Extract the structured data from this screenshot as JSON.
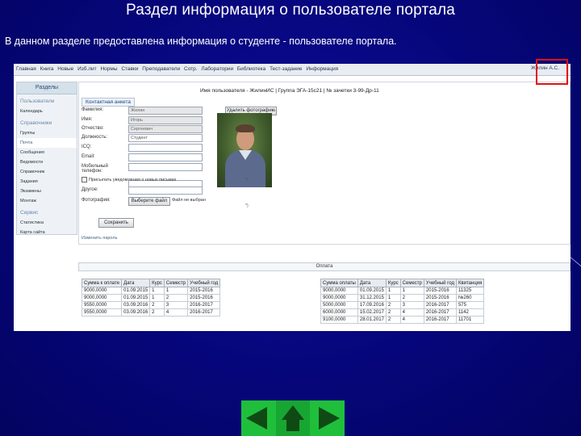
{
  "slide": {
    "title": "Раздел информация о пользователе портала",
    "subtitle": "В данном разделе предоставлена информация о студенте - пользователе портала."
  },
  "topnav": {
    "items": [
      "Главная",
      "Книга",
      "Новые",
      "Изб.лит",
      "Нормы",
      "Ставки",
      "Преподаватели",
      "Сотр.",
      "Лаборатории",
      "Библиотека",
      "Тест-задание",
      "Информация"
    ],
    "user_link": "Жилин А.С."
  },
  "sidebar": {
    "header": "Разделы",
    "items": [
      {
        "label": "Пользователи",
        "kind": "section"
      },
      {
        "label": "Календарь",
        "kind": "item"
      },
      {
        "label": "Справочники",
        "kind": "section"
      },
      {
        "label": "Группы",
        "kind": "item"
      },
      {
        "label": "Почта",
        "kind": "selected"
      },
      {
        "label": "Сообщения",
        "kind": "item"
      },
      {
        "label": "Ведомости",
        "kind": "item"
      },
      {
        "label": "Справочник",
        "kind": "item"
      },
      {
        "label": "Задания",
        "kind": "item"
      },
      {
        "label": "Экзамены",
        "kind": "item"
      },
      {
        "label": "Монтаж",
        "kind": "item"
      },
      {
        "label": "Сервис",
        "kind": "section"
      },
      {
        "label": "Статистика",
        "kind": "item"
      },
      {
        "label": "Карта сайта",
        "kind": "item"
      }
    ]
  },
  "profile": {
    "header": "Имя пользователя - ЖилинИС | Группа ЭГА-15с21 | № зачетки 3-99-Др-11",
    "tab_label": "Контактная анкета",
    "delete_photo_label": "Удалить фотографию",
    "fields": [
      {
        "label": "Фамилия:",
        "value": "Жилин",
        "readonly": true
      },
      {
        "label": "Имя:",
        "value": "Игорь",
        "readonly": true
      },
      {
        "label": "Отчество:",
        "value": "Сергеевич",
        "readonly": true
      },
      {
        "label": "Должность:",
        "value": "Студент",
        "readonly": false
      },
      {
        "label": "ICQ:",
        "value": "",
        "readonly": false
      },
      {
        "label": "Email:",
        "value": "",
        "readonly": false
      },
      {
        "label": "Мобильный телефон:",
        "value": "",
        "readonly": false
      },
      {
        "label": "",
        "value": "",
        "readonly": false
      }
    ],
    "checkbox_label": "Присылать уведомления о новых письмах",
    "other_label": "Другое:",
    "photo_label": "Фотография:",
    "browse_label": "Выберите файл",
    "file_status": "Файл не выбран",
    "save_label": "Сохранить",
    "side_marks": [
      "*)",
      "*)"
    ],
    "footnote": "Изменить пароль"
  },
  "tables": {
    "bar_label": "Оплата",
    "headers_left": [
      "Сумма к оплате",
      "Дата",
      "Курс",
      "Семестр",
      "Учебный год"
    ],
    "rows_left": [
      [
        "9000,0000",
        "01.09.2015",
        "1",
        "1",
        "2015-2016"
      ],
      [
        "9000,0000",
        "01.09.2015",
        "1",
        "2",
        "2015-2016"
      ],
      [
        "9550,0000",
        "03.09.2016",
        "2",
        "3",
        "2016-2017"
      ],
      [
        "9550,0000",
        "03.09.2016",
        "2",
        "4",
        "2016-2017"
      ]
    ],
    "headers_right": [
      "Сумма оплаты",
      "Дата",
      "Курс",
      "Семестр",
      "Учебный год",
      "Квитанция"
    ],
    "rows_right": [
      [
        "9000,0000",
        "01.09.2015",
        "1",
        "1",
        "2015-2016",
        "11325"
      ],
      [
        "9000,0000",
        "31.12.2015",
        "1",
        "2",
        "2015-2016",
        "№260"
      ],
      [
        "5000,0000",
        "17.09.2016",
        "2",
        "3",
        "2016-2017",
        "575"
      ],
      [
        "6000,0000",
        "15.02.2017",
        "2",
        "4",
        "2016-2017",
        "1142"
      ],
      [
        "9100,0000",
        "28.01.2017",
        "2",
        "4",
        "2016-2017",
        "11701"
      ]
    ]
  },
  "colors": {
    "slide_background": "#06067a",
    "highlight_frame": "#e01010",
    "nav_box": "#1fbf3c"
  }
}
